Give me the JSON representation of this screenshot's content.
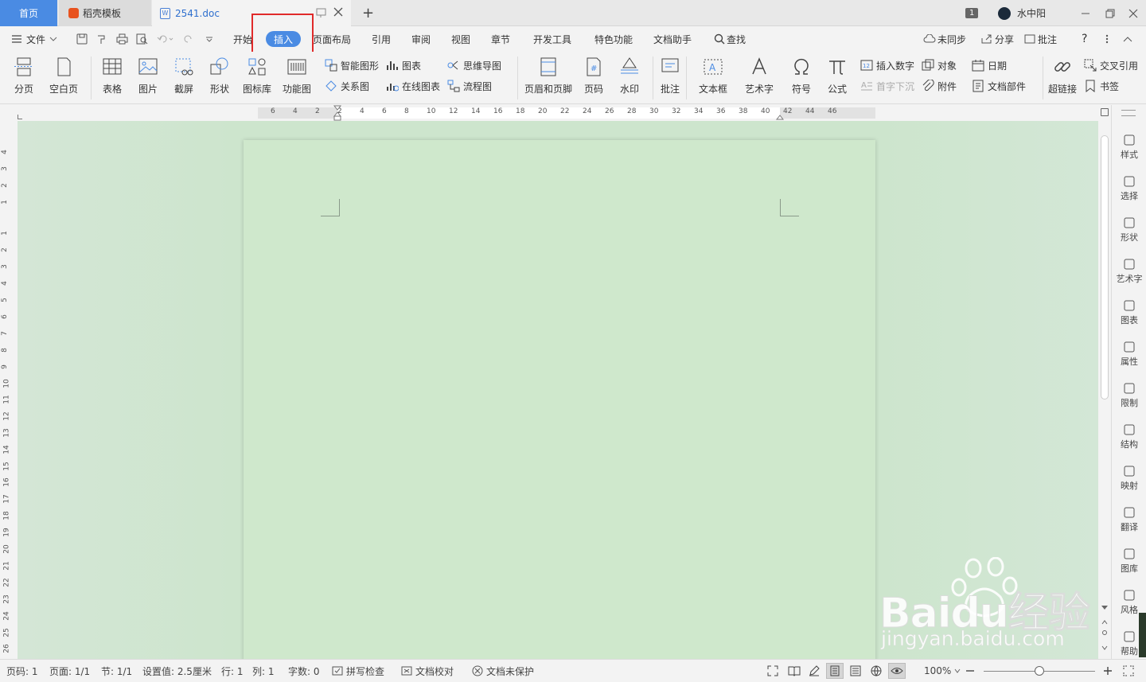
{
  "titlebar": {
    "tabs": [
      {
        "label": "首页"
      },
      {
        "label": "稻壳模板"
      },
      {
        "label": "2541.doc"
      }
    ],
    "new_tab": "+",
    "window_count": "1",
    "user": "水中阳"
  },
  "menubar": {
    "file": "文件",
    "tabs": [
      "开始",
      "插入",
      "页面布局",
      "引用",
      "审阅",
      "视图",
      "章节",
      "开发工具",
      "特色功能",
      "文档助手"
    ],
    "search": "查找",
    "sync": "未同步",
    "share": "分享",
    "comment": "批注",
    "help": "?"
  },
  "ribbon": {
    "page_break": "分页",
    "blank_page": "空白页",
    "table": "表格",
    "picture": "图片",
    "screenshot": "截屏",
    "shape": "形状",
    "icon_lib": "图标库",
    "func_chart": "功能图",
    "smart_art": "智能图形",
    "chart": "图表",
    "mind_map": "思维导图",
    "relation": "关系图",
    "online_chart": "在线图表",
    "flowchart": "流程图",
    "header_footer": "页眉和页脚",
    "page_number": "页码",
    "watermark": "水印",
    "comment": "批注",
    "textbox": "文本框",
    "word_art": "艺术字",
    "symbol": "符号",
    "formula": "公式",
    "insert_number": "插入数字",
    "object": "对象",
    "date": "日期",
    "drop_cap": "首字下沉",
    "attachment": "附件",
    "doc_parts": "文档部件",
    "hyperlink": "超链接",
    "cross_ref": "交叉引用",
    "bookmark": "书签"
  },
  "ruler": {
    "h_ticks": [
      "6",
      "4",
      "2",
      "2",
      "4",
      "6",
      "8",
      "10",
      "12",
      "14",
      "16",
      "18",
      "20",
      "22",
      "24",
      "26",
      "28",
      "30",
      "32",
      "34",
      "36",
      "38",
      "40",
      "42",
      "44",
      "46"
    ],
    "v_ticks": [
      "4",
      "3",
      "2",
      "1",
      "1",
      "2",
      "3",
      "4",
      "5",
      "6",
      "7",
      "8",
      "9",
      "10",
      "11",
      "12",
      "13",
      "14",
      "15",
      "16",
      "17",
      "18",
      "19",
      "20",
      "21",
      "22",
      "23",
      "24",
      "25",
      "26"
    ]
  },
  "rightpanel": [
    "样式",
    "选择",
    "形状",
    "艺术字",
    "图表",
    "属性",
    "限制",
    "结构",
    "映射",
    "翻译",
    "图库",
    "风格",
    "帮助"
  ],
  "status": {
    "page_no": "页码: 1",
    "page": "页面: 1/1",
    "section": "节: 1/1",
    "setting": "设置值: 2.5厘米",
    "row": "行: 1",
    "col": "列: 1",
    "words": "字数: 0",
    "spell": "拼写检查",
    "proof": "文档校对",
    "protect": "文档未保护",
    "zoom": "100%"
  },
  "watermark": {
    "brand": "Baidu经验",
    "url": "jingyan.baidu.com"
  },
  "colors": {
    "accent": "#4a8be3",
    "highlight": "#e02a2a",
    "page": "#cfe8cc"
  }
}
